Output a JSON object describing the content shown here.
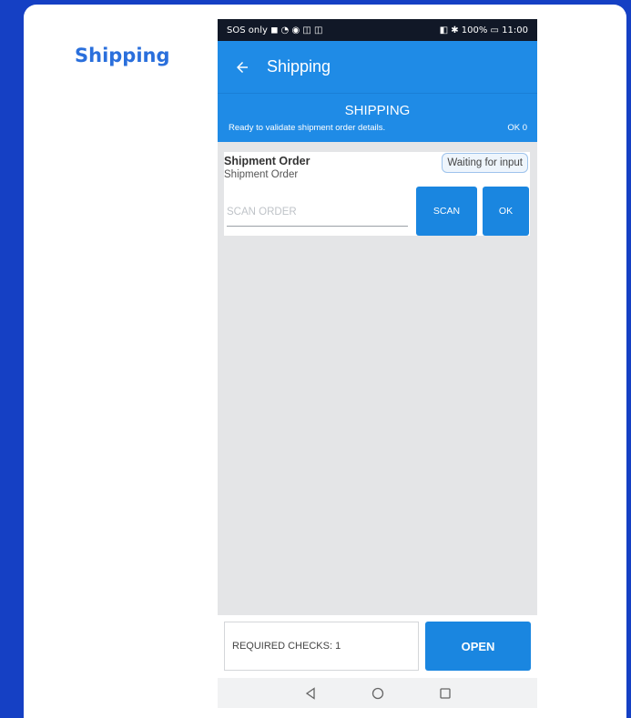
{
  "page": {
    "title": "Shipping"
  },
  "status_bar": {
    "left": "SOS only ◼ ◔ ◉ ◫ ◫",
    "right": "◧ ✱ 100% ▭ 11:00"
  },
  "app_bar": {
    "title": "Shipping"
  },
  "header": {
    "title": "SHIPPING",
    "subtitle": "Ready to validate shipment order details.",
    "ok_count": "OK 0"
  },
  "shipment": {
    "title": "Shipment Order",
    "subtitle": "Shipment Order",
    "status": "Waiting for input",
    "input_value": "",
    "input_placeholder": "SCAN ORDER",
    "scan_label": "SCAN",
    "ok_label": "OK"
  },
  "footer": {
    "required_checks": "REQUIRED CHECKS: 1",
    "open_label": "OPEN"
  },
  "colors": {
    "accent": "#1f8be6",
    "brand_title": "#2a6fdc",
    "background": "#1540c4"
  },
  "icons": [
    "back-arrow-icon",
    "nav-back-icon",
    "nav-home-icon",
    "nav-recents-icon"
  ]
}
